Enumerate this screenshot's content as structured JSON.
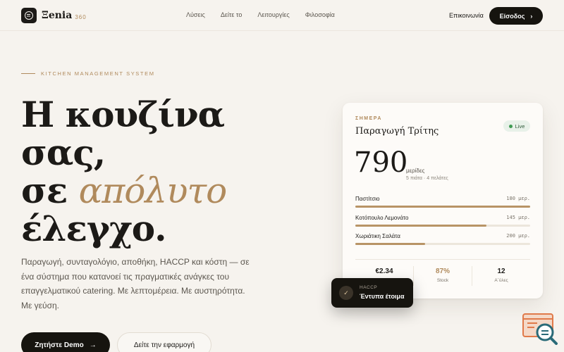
{
  "nav": {
    "logo_text": "Ξenia",
    "logo_sub": "360",
    "links": [
      "Λύσεις",
      "Δείτε το",
      "Λειτουργίες",
      "Φιλοσοφία"
    ],
    "contact": "Επικοινωνία",
    "login": "Είσοδος"
  },
  "hero": {
    "eyebrow": "KITCHEN MANAGEMENT SYSTEM",
    "line1": "Η κουζίνα",
    "line2": "σας,",
    "line3a": "σε ",
    "line3b": "απόλυτο",
    "line4": "έλεγχο.",
    "lead": "Παραγωγή, συνταγολόγιο, αποθήκη, HACCP και κόστη — σε ένα σύστημα που κατανοεί τις πραγματικές ανάγκες του επαγγελματικού catering. Με λεπτομέρεια. Με αυστηρότητα. Με γεύση.",
    "cta_primary": "Ζητήστε Demo",
    "cta_secondary": "Δείτε την εφαρμογή"
  },
  "card": {
    "today": "ΣΗΜΕΡΑ",
    "title": "Παραγωγή Τρίτης",
    "status": "Live",
    "total": "790",
    "unit": "μερίδες",
    "sub": "5 πιάτα · 4 πελάτες",
    "items": [
      {
        "name": "Παστίτσιο",
        "value": "180 μερ.",
        "fill": 1.0
      },
      {
        "name": "Κοτόπουλο Λεμονάτο",
        "value": "145 μερ.",
        "fill": 0.75
      },
      {
        "name": "Χωριάτικη Σαλάτα",
        "value": "200 μερ.",
        "fill": 0.4
      }
    ],
    "stats": [
      {
        "value": "€2.34",
        "label": ""
      },
      {
        "value": "87%",
        "label": "Stock"
      },
      {
        "value": "12",
        "label": "Α΄ύλες"
      }
    ]
  },
  "toast": {
    "label": "HACCP",
    "value": "Έντυπα έτοιμα"
  },
  "colors": {
    "accent": "#b08a5c",
    "dark": "#16140f",
    "background": "#f6f3ee"
  }
}
